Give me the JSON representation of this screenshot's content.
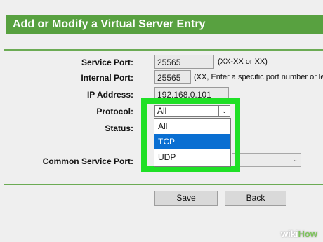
{
  "header": {
    "title": "Add or Modify a Virtual Server Entry"
  },
  "form": {
    "service_port": {
      "label": "Service Port:",
      "value": "25565",
      "hint": "(XX-XX or XX)"
    },
    "internal_port": {
      "label": "Internal Port:",
      "value": "25565",
      "hint": "(XX, Enter a specific port number or le"
    },
    "ip_address": {
      "label": "IP Address:",
      "value": "192.168.0.101"
    },
    "protocol": {
      "label": "Protocol:",
      "selected": "All",
      "options": [
        "All",
        "TCP",
        "UDP"
      ],
      "highlighted_option": "TCP"
    },
    "status": {
      "label": "Status:"
    },
    "common_service_port": {
      "label": "Common Service Port:",
      "value": ""
    }
  },
  "buttons": {
    "save": "Save",
    "back": "Back"
  },
  "watermark": {
    "wiki": "wiki",
    "how": "How"
  },
  "colors": {
    "header_bg": "#58a140",
    "highlight_border": "#1fe026",
    "selected_option": "#0a6fd2"
  }
}
